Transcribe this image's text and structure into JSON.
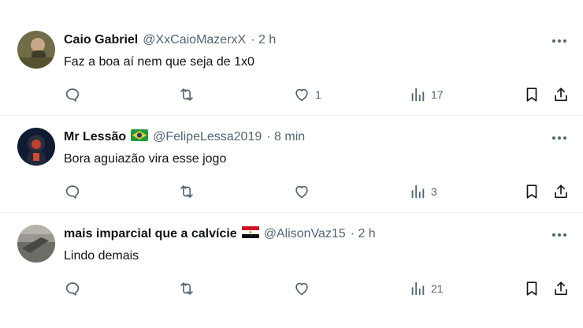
{
  "tweets": [
    {
      "name": "Caio Gabriel",
      "flag": "",
      "handle": "@XxCaioMazerxX",
      "time": "· 2 h",
      "text": "Faz a boa aí nem que seja de 1x0",
      "replies": "",
      "retweets": "",
      "likes": "1",
      "views": "17",
      "avatar_color": "#7d7a52"
    },
    {
      "name": "Mr Lessão",
      "flag": "brazil-flag-icon",
      "handle": "@FelipeLessa2019",
      "time": "· 8 min",
      "text": "Bora aguiazão vira esse jogo",
      "replies": "",
      "retweets": "",
      "likes": "",
      "views": "3",
      "avatar_color": "#1e2a4a"
    },
    {
      "name": "mais imparcial que a calvície",
      "flag": "egypt-flag-icon",
      "handle": "@AlisonVaz15",
      "time": "· 2 h",
      "text": "Lindo demais",
      "replies": "",
      "retweets": "",
      "likes": "",
      "views": "21",
      "avatar_color": "#8a8a84"
    }
  ]
}
